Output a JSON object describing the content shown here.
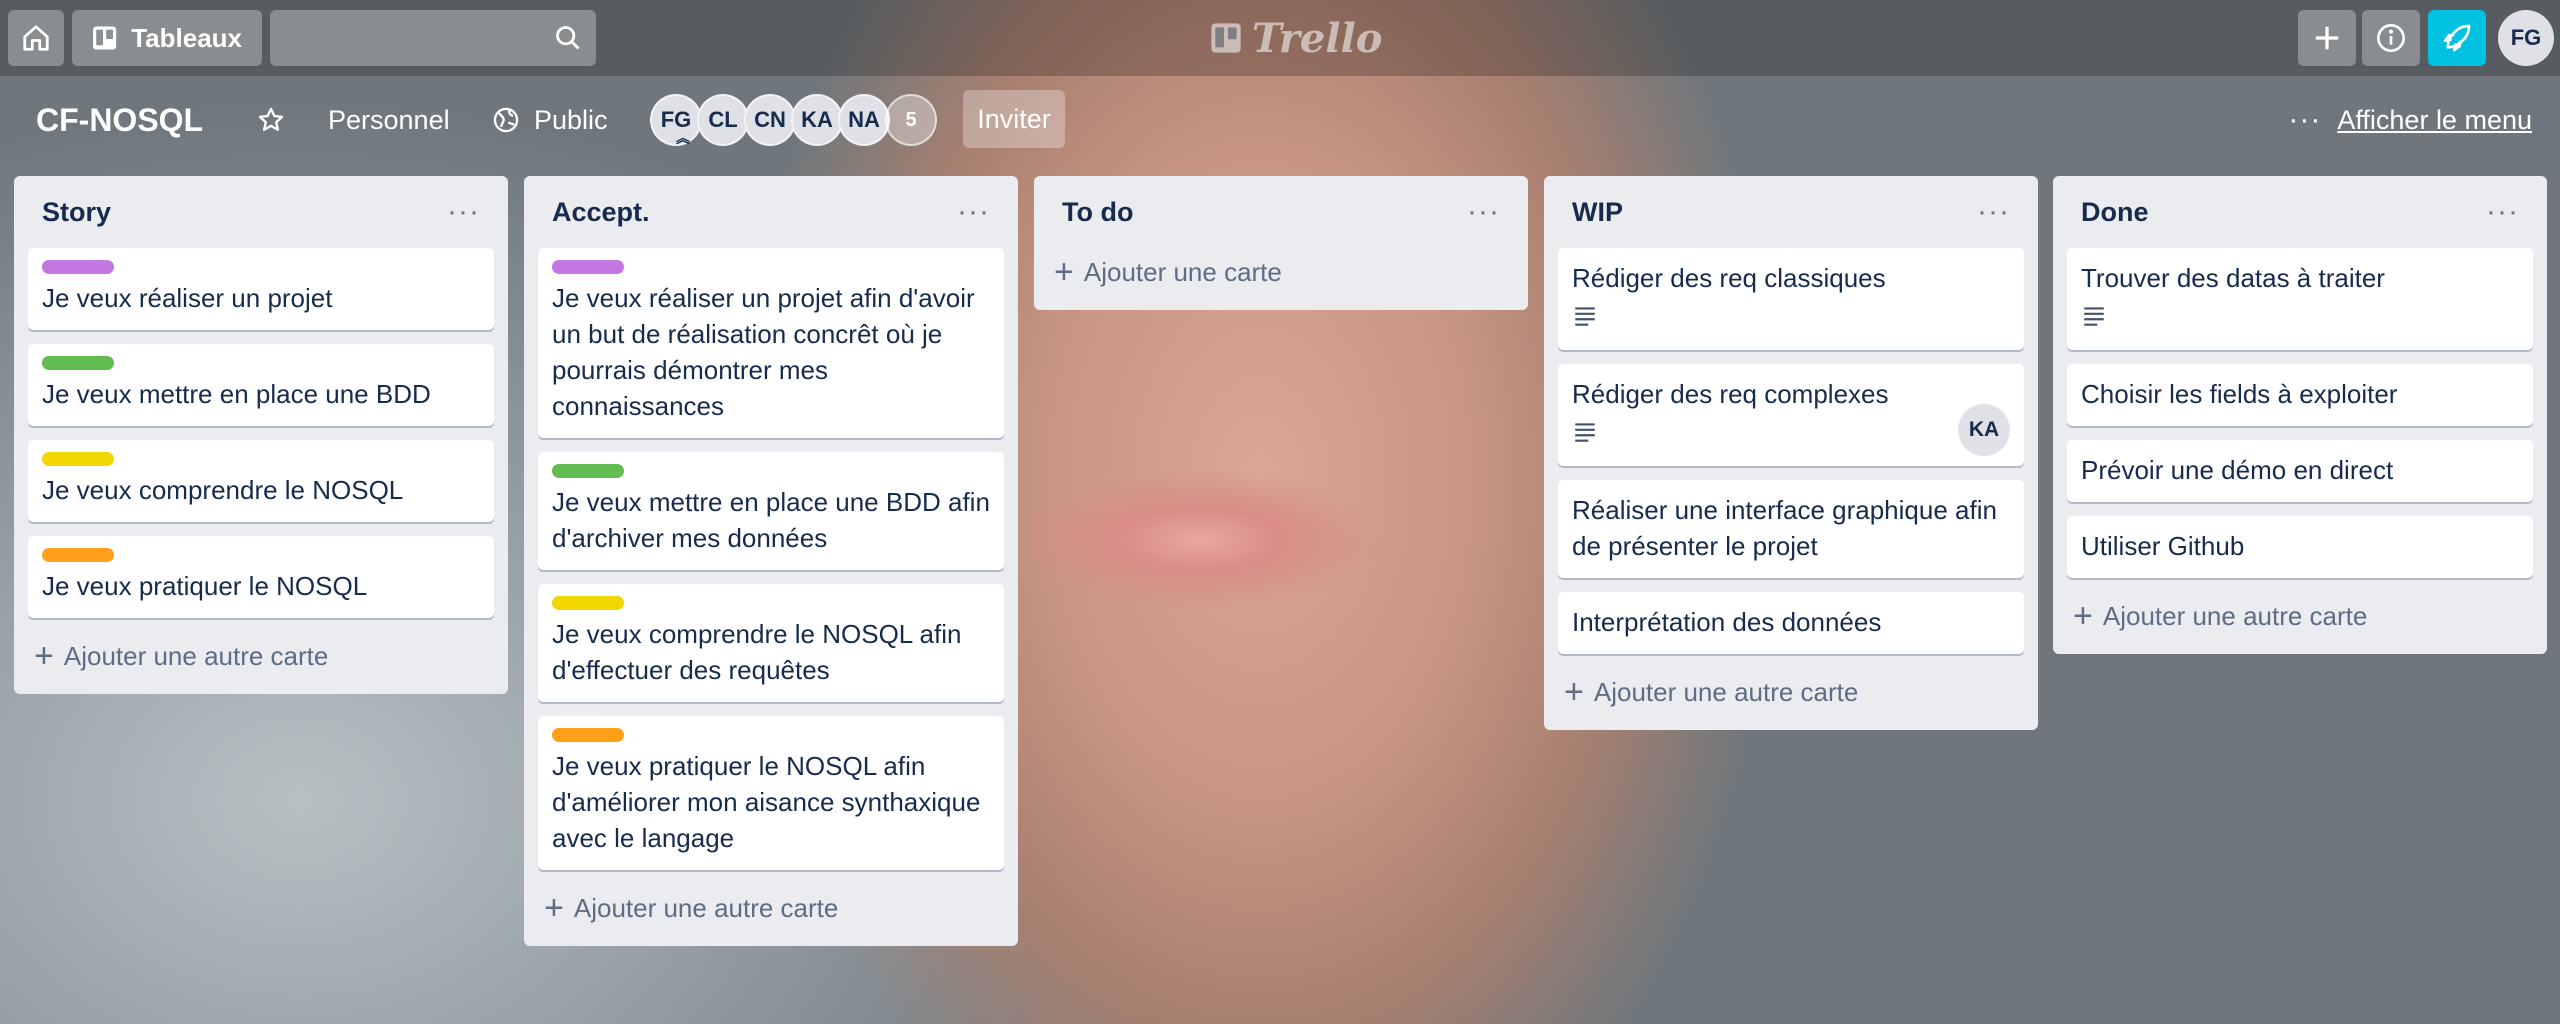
{
  "header": {
    "boards_label": "Tableaux",
    "search_placeholder": "",
    "logo_text": "Trello",
    "user_initials": "FG",
    "notify_color": "#00c2e0"
  },
  "board": {
    "title": "CF-NOSQL",
    "team": "Personnel",
    "visibility": "Public",
    "members": [
      "FG",
      "CL",
      "CN",
      "KA",
      "NA"
    ],
    "more_members": "5",
    "invite_label": "Inviter",
    "menu_label": "Afficher le menu"
  },
  "lists": [
    {
      "title": "Story",
      "cards": [
        {
          "label_color": "#c377e0",
          "text": "Je veux réaliser un projet"
        },
        {
          "label_color": "#61bd4f",
          "text": "Je veux mettre en place une BDD"
        },
        {
          "label_color": "#f2d600",
          "text": "Je veux comprendre le NOSQL"
        },
        {
          "label_color": "#ff9f1a",
          "text": "Je veux pratiquer le NOSQL"
        }
      ],
      "add_label": "Ajouter une autre carte"
    },
    {
      "title": "Accept.",
      "cards": [
        {
          "label_color": "#c377e0",
          "text": "Je veux réaliser un projet afin d'avoir un but de réalisation concrêt où je pourrais démontrer mes connaissances"
        },
        {
          "label_color": "#61bd4f",
          "text": "Je veux mettre en place une BDD afin d'archiver mes données"
        },
        {
          "label_color": "#f2d600",
          "text": "Je veux comprendre le NOSQL afin d'effectuer des requêtes"
        },
        {
          "label_color": "#ff9f1a",
          "text": "Je veux pratiquer le NOSQL afin d'améliorer mon aisance synthaxique avec le langage"
        }
      ],
      "add_label": "Ajouter une autre carte"
    },
    {
      "title": "To do",
      "cards": [],
      "add_label": "Ajouter une carte"
    },
    {
      "title": "WIP",
      "cards": [
        {
          "text": "Rédiger des req classiques",
          "has_description": true
        },
        {
          "text": "Rédiger des req complexes",
          "has_description": true,
          "member": "KA"
        },
        {
          "text": "Réaliser une interface graphique afin de présenter le projet"
        },
        {
          "text": "Interprétation des données"
        }
      ],
      "add_label": "Ajouter une autre carte"
    },
    {
      "title": "Done",
      "cards": [
        {
          "text": "Trouver des datas à traiter",
          "has_description": true
        },
        {
          "text": "Choisir les fields à exploiter"
        },
        {
          "text": "Prévoir une démo en direct"
        },
        {
          "text": "Utiliser Github"
        }
      ],
      "add_label": "Ajouter une autre carte"
    }
  ]
}
